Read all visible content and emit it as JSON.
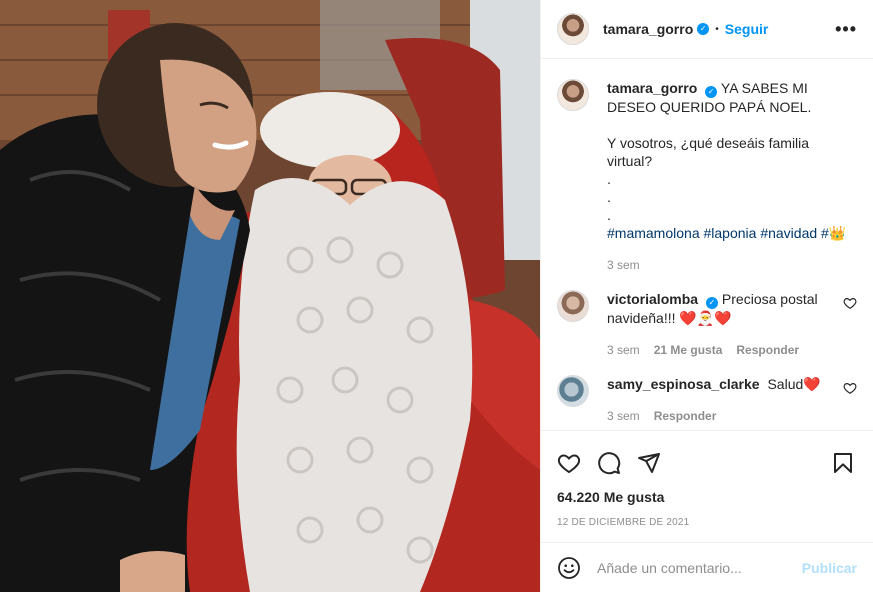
{
  "post": {
    "username": "tamara_gorro",
    "follow_label": "Seguir",
    "separator": "•",
    "more_label": "•••",
    "verified_mark": "✓"
  },
  "caption": {
    "username": "tamara_gorro",
    "line1": "YA SABES MI DESEO QUERIDO PAPÁ NOEL.",
    "line2": "Y vosotros, ¿qué deseáis familia virtual?",
    "dot": ".",
    "hashtags": "#mamamolona #laponia #navidad #",
    "emoji": "👑",
    "time": "3 sem"
  },
  "comments": [
    {
      "username": "victorialomba",
      "text": "Preciosa postal navideña!!!",
      "emoji": "❤️🎅❤️",
      "time": "3 sem",
      "likes": "21 Me gusta",
      "reply": "Responder"
    },
    {
      "username": "samy_espinosa_clarke",
      "text": "Salud",
      "emoji": "❤️",
      "time": "3 sem",
      "reply": "Responder"
    }
  ],
  "stats": {
    "likes": "64.220 Me gusta",
    "date": "12 DE DICIEMBRE DE 2021"
  },
  "add_comment": {
    "placeholder": "Añade un comentario...",
    "publish": "Publicar"
  },
  "icons": {
    "like": "heart-icon",
    "comment": "comment-icon",
    "share": "send-icon",
    "save": "bookmark-icon",
    "emoji": "emoji-icon"
  },
  "colors": {
    "link": "#0095f6",
    "hashtag": "#00376b",
    "muted": "#8e8e8e",
    "publish_disabled": "#b2dffc"
  }
}
